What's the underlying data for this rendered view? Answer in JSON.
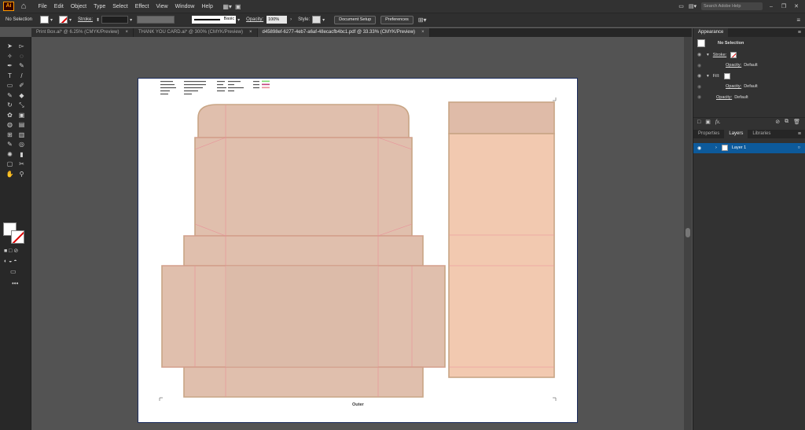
{
  "app": {
    "logo": "Ai"
  },
  "menubar": {
    "items": [
      "File",
      "Edit",
      "Object",
      "Type",
      "Select",
      "Effect",
      "View",
      "Window",
      "Help"
    ],
    "search_placeholder": "Search Adobe Help"
  },
  "control": {
    "selection": "No Selection",
    "stroke_label": "Stroke:",
    "brush": "Basic",
    "opacity_label": "Opacity:",
    "opacity_value": "100%",
    "style_label": "Style:",
    "doc_setup": "Document Setup",
    "preferences": "Preferences"
  },
  "tabs": [
    {
      "label": "Print Box.ai* @ 6.25% (CMYK/Preview)",
      "active": false
    },
    {
      "label": "THANK YOU CARD.ai* @ 300% (CMYK/Preview)",
      "active": false
    },
    {
      "label": "d45898ef-6277-4eb7-a6af-48ecacfb4bc1.pdf @ 33.33% (CMYK/Preview)",
      "active": true
    }
  ],
  "tab_close": "×",
  "artwork": {
    "caption": "Outer",
    "colors": {
      "box_fill": "#e0bfad",
      "panel_fill": "#f2c9b0",
      "outline": "#c8a585",
      "fold": "#e98f98"
    }
  },
  "appearance": {
    "title": "Appearance",
    "header": "No Selection",
    "stroke_label": "Stroke:",
    "opacity_label": "Opacity:",
    "opacity_value": "Default",
    "fill_label": "Fill:",
    "fx": "fx."
  },
  "layers": {
    "tabs": [
      "Properties",
      "Layers",
      "Libraries"
    ],
    "active": "Layers",
    "layer_name": "Layer 1"
  }
}
